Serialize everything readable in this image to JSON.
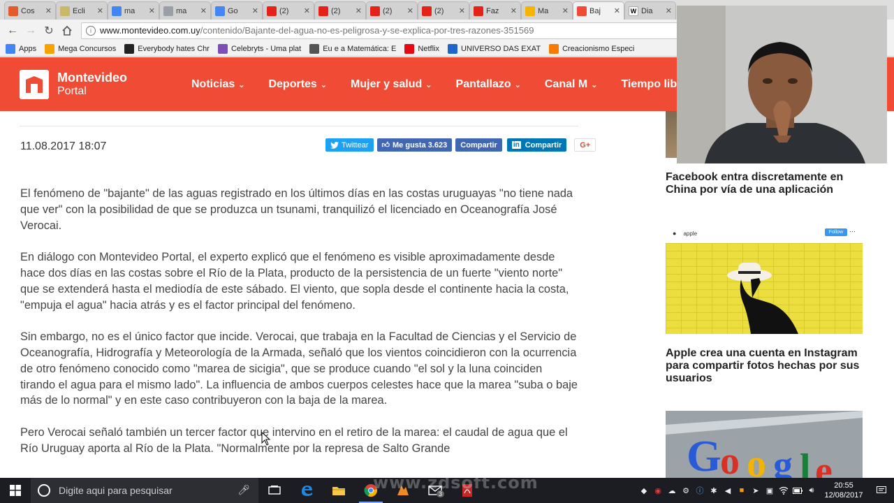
{
  "browser": {
    "tabs": [
      {
        "label": "Cos",
        "color": "#e45a2b"
      },
      {
        "label": "Ecli",
        "color": "#c9b86a"
      },
      {
        "label": "ma",
        "color": "#4285f4"
      },
      {
        "label": "ma",
        "color": "#9aa0a6"
      },
      {
        "label": "Go",
        "color": "#4285f4"
      },
      {
        "label": "(2)",
        "color": "#e62117"
      },
      {
        "label": "(2)",
        "color": "#e62117"
      },
      {
        "label": "(2)",
        "color": "#e62117"
      },
      {
        "label": "(2)",
        "color": "#e62117"
      },
      {
        "label": "Faz",
        "color": "#e62117"
      },
      {
        "label": "Ma",
        "color": "#f4b400"
      },
      {
        "label": "Baj",
        "color": "#ef4b35"
      },
      {
        "label": "Dia",
        "color": "#ffffff"
      }
    ],
    "url_host": "www.montevideo.com.uy",
    "url_path": "/contenido/Bajante-del-agua-no-es-peligrosa-y-se-explica-por-tres-razones-351569",
    "bookmarks": [
      {
        "label": "Apps",
        "color": "#4285f4"
      },
      {
        "label": "Mega Concursos",
        "color": "#f4a300"
      },
      {
        "label": "Everybody hates Chr",
        "color": "#222222"
      },
      {
        "label": "Celebryts - Uma plat",
        "color": "#7b4fb5"
      },
      {
        "label": "Eu e a Matemática: E",
        "color": "#555555"
      },
      {
        "label": "Netflix",
        "color": "#e50914"
      },
      {
        "label": "UNIVERSO DAS EXAT",
        "color": "#1e66c9"
      },
      {
        "label": "Creacionismo Especi",
        "color": "#f57c00"
      }
    ]
  },
  "site": {
    "logo_line1": "Montevideo",
    "logo_line2": "Portal",
    "menu": [
      "Noticias",
      "Deportes",
      "Mujer y salud",
      "Pantallazo",
      "Canal M",
      "Tiempo libre"
    ]
  },
  "article": {
    "date": "11.08.2017 18:07",
    "share": {
      "twitter": "Twittear",
      "like": "Me gusta 3.623",
      "fb_share": "Compartir",
      "li_share": "Compartir",
      "gplus": "G+"
    },
    "paragraphs": [
      "El fenómeno de \"bajante\" de las aguas registrado en los últimos días en las costas uruguayas \"no tiene nada que ver\" con la posibilidad de que se produzca un tsunami, tranquilizó el licenciado en Oceanografía José Verocai.",
      "En diálogo con Montevideo Portal, el experto explicó que el fenómeno es visible aproximadamente desde hace dos días en las costas sobre el Río de la Plata, producto de la persistencia de un fuerte \"viento norte\" que se extenderá hasta el mediodía de este sábado. El viento, que sopla desde el continente hacia la costa, \"empuja el agua\" hacia atrás y es el factor principal del fenómeno.",
      "Sin embargo, no es el único factor que incide. Verocai, que trabaja en la Facultad de Ciencias y el Servicio de Oceanografía, Hidrografía y Meteorología de la Armada, señaló que los vientos coincidieron con la ocurrencia de otro fenómeno conocido como \"marea de sicigia\", que se produce cuando \"el sol y la luna coinciden tirando el agua para el mismo lado\". La influencia de ambos cuerpos celestes hace que la marea \"suba o baje más de lo normal\" y en este caso contribuyeron con la baja de la marea.",
      "Pero Verocai señaló también un tercer factor que intervino en el retiro de la marea: el caudal de agua que el Río Uruguay aporta al Río de la Plata. \"Normalmente por la represa de Salto Grande"
    ]
  },
  "sidebar": {
    "story1_title": "Facebook entra discretamente en China por vía de una aplicación",
    "story2_title": "Apple crea una cuenta en Instagram para compartir fotos hechas por sus usuarios",
    "insta_account": "apple",
    "insta_follow": "Follow"
  },
  "taskbar": {
    "search_placeholder": "Digite aqui para pesquisar",
    "time": "20:55",
    "date": "12/08/2017",
    "mail_badge": "3"
  },
  "watermark": "www.zdsoft.com"
}
